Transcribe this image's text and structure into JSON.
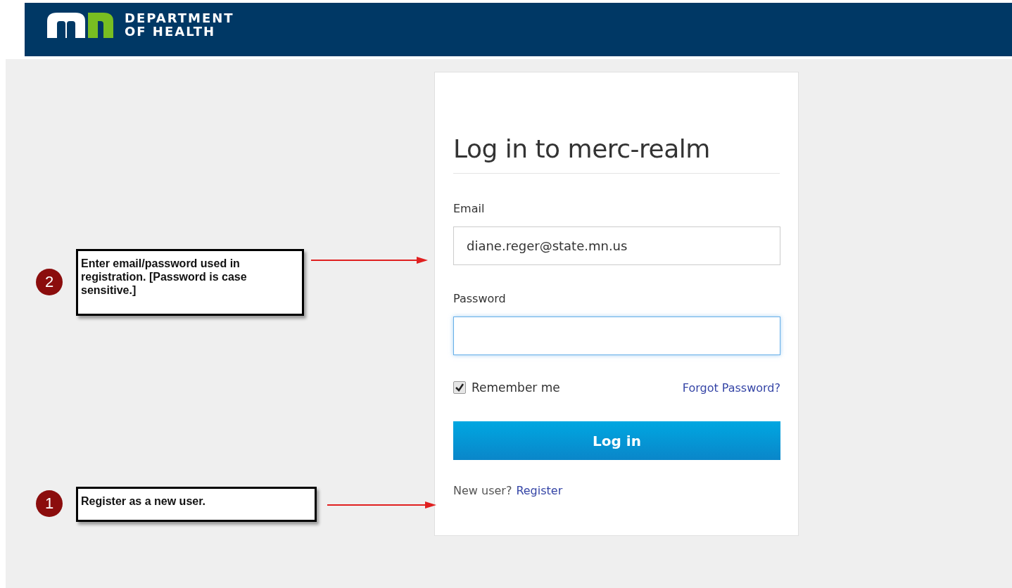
{
  "header": {
    "logo_line_1": "DEPARTMENT",
    "logo_line_2": "OF HEALTH"
  },
  "login_card": {
    "title": "Log in to merc-realm",
    "fields": [
      {
        "label": "Email",
        "value": "diane.reger@state.mn.us",
        "focused": false
      },
      {
        "label": "Password",
        "focused": true
      }
    ],
    "remember_me": {
      "label": "Remember me",
      "checked": true
    },
    "forgot_link": "Forgot Password?",
    "submit_button": "Log in",
    "register_prompt": "New user?",
    "register_link": "Register"
  },
  "annotations": [
    {
      "number": "2",
      "text": "Enter email/password used in registration. [Password is case sensitive.]"
    },
    {
      "number": "1",
      "text": "Register as a new user."
    }
  ]
}
